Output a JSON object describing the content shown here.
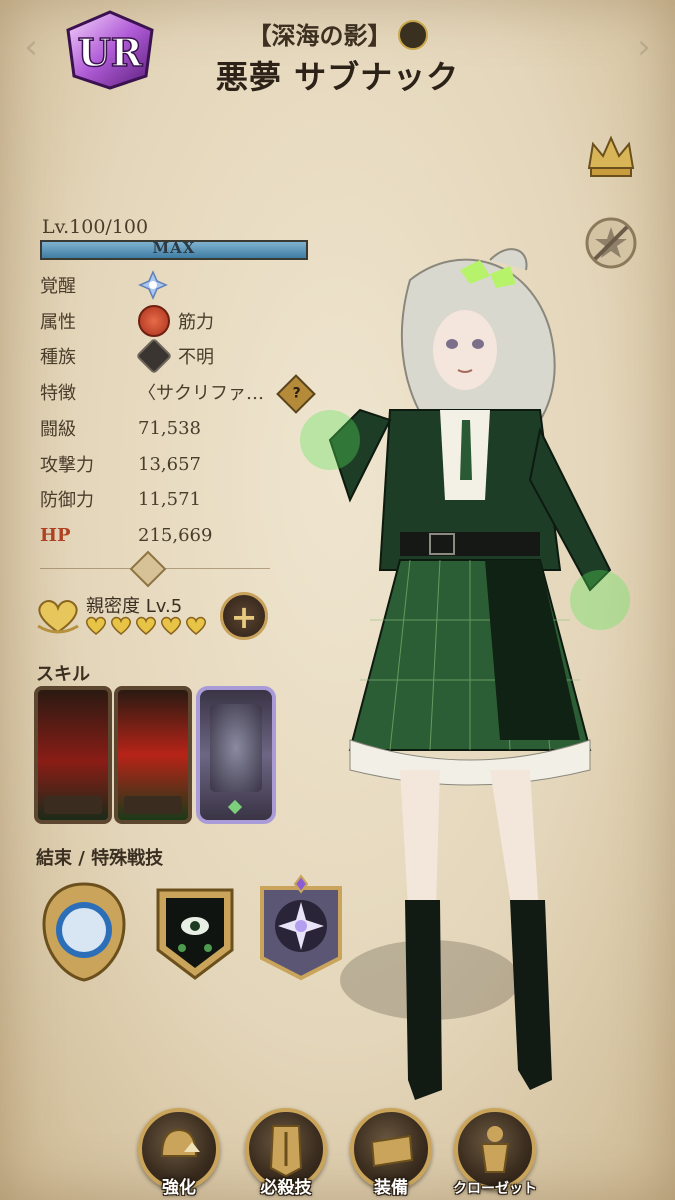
{
  "header": {
    "rarity": "UR",
    "title_sub": "【深海の影】",
    "title_main": "悪夢 サブナック",
    "nav_prev_icon": "chevron-left-icon",
    "nav_next_icon": "chevron-right-icon"
  },
  "side_buttons": [
    {
      "icon": "crown-icon"
    },
    {
      "icon": "star-slash-icon"
    }
  ],
  "level": {
    "label": "Lv.100/100",
    "bar_text": "MAX",
    "progress": 1.0
  },
  "stats": {
    "awakening_label": "覚醒",
    "attribute_label": "属性",
    "attribute_value": "筋力",
    "race_label": "種族",
    "race_value": "不明",
    "trait_label": "特徴",
    "trait_value": "〈サクリファ…",
    "rank_label": "闘級",
    "rank_value": "71,538",
    "attack_label": "攻撃力",
    "attack_value": "13,657",
    "defense_label": "防御力",
    "defense_value": "11,571",
    "hp_label": "HP",
    "hp_value": "215,669"
  },
  "affinity": {
    "label": "親密度 Lv.5",
    "hearts": 5,
    "plus_label": "+"
  },
  "skills": {
    "title": "スキル",
    "cards": [
      "skill-card-1",
      "skill-card-2",
      "skill-card-ultimate"
    ]
  },
  "bonds": {
    "title": "結束 / 特殊戦技"
  },
  "bottom_nav": [
    {
      "label": "強化",
      "icon": "helmet-upgrade-icon"
    },
    {
      "label": "必殺技",
      "icon": "sword-emblem-icon"
    },
    {
      "label": "装備",
      "icon": "equipment-icon"
    },
    {
      "label": "クローゼット",
      "icon": "closet-icon"
    }
  ],
  "colors": {
    "background": "#e4d6ba",
    "gold": "#c9a45a",
    "hp_red": "#b04224",
    "level_bar": "#3f7da3",
    "outfit_green": "#1f4a2a"
  }
}
